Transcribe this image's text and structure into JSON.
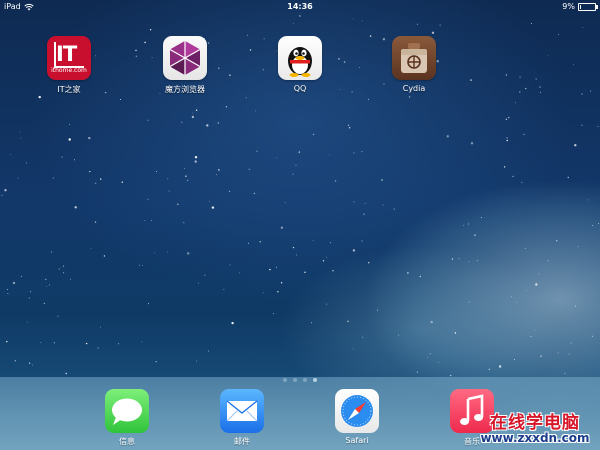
{
  "status_bar": {
    "device": "iPad",
    "time": "14:36",
    "battery_percent_text": "9%",
    "battery_level": 0.09
  },
  "home_apps": [
    {
      "label": "IT之家",
      "icon": "ithome-icon",
      "icon_text": "IT",
      "icon_subtext": "ithome.com"
    },
    {
      "label": "魔方浏览器",
      "icon": "mofang-browser-icon"
    },
    {
      "label": "QQ",
      "icon": "qq-penguin-icon"
    },
    {
      "label": "Cydia",
      "icon": "cydia-icon"
    }
  ],
  "page_indicator": {
    "count": 4,
    "active_index": 3
  },
  "dock_apps": [
    {
      "label": "信息",
      "icon": "messages-icon"
    },
    {
      "label": "邮件",
      "icon": "mail-icon"
    },
    {
      "label": "Safari",
      "icon": "safari-compass-icon"
    },
    {
      "label": "音乐",
      "icon": "music-note-icon"
    }
  ],
  "watermark": {
    "line1": "在线学电脑",
    "line2": "www.zxxdn.com"
  },
  "colors": {
    "ithome_red": "#c8102e",
    "messages_green": "#2fc43a",
    "mail_blue": "#1a6fe8",
    "music_red": "#ef2a4d",
    "cydia_brown": "#6b4028"
  }
}
